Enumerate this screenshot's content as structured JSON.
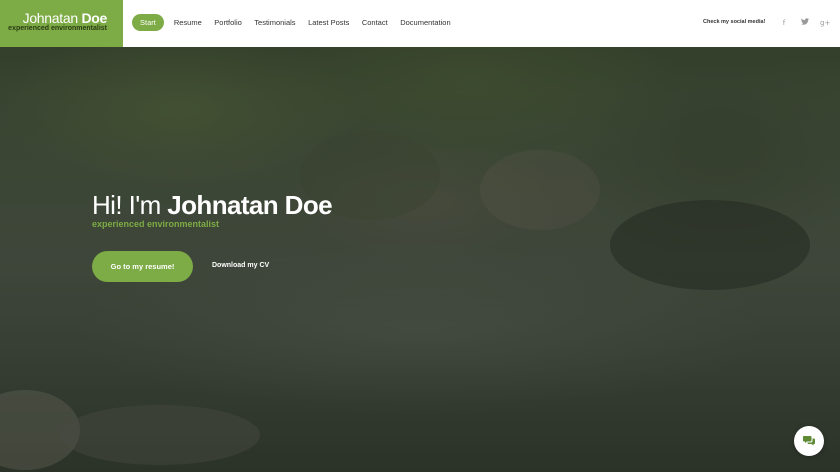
{
  "brand": {
    "first_name": "Johnatan",
    "last_name": "Doe",
    "tagline": "experienced environmentalist"
  },
  "nav": {
    "items": [
      {
        "label": "Start",
        "active": true
      },
      {
        "label": "Resume"
      },
      {
        "label": "Portfolio"
      },
      {
        "label": "Testimonials"
      },
      {
        "label": "Latest Posts"
      },
      {
        "label": "Contact"
      },
      {
        "label": "Documentation"
      }
    ]
  },
  "social": {
    "label": "Check my social media!",
    "icons": [
      {
        "name": "facebook-icon",
        "glyph": "f"
      },
      {
        "name": "twitter-icon",
        "glyph": "t"
      },
      {
        "name": "google-plus-icon",
        "glyph": "g+"
      }
    ]
  },
  "hero": {
    "greeting": "Hi! I'm",
    "name": "Johnatan Doe",
    "subtitle": "experienced environmentalist",
    "primary_button": "Go to my resume!",
    "secondary_link": "Download my CV"
  },
  "chat": {
    "icon": "chat-icon"
  },
  "colors": {
    "accent": "#7dab45",
    "header_bg": "#ffffff",
    "nav_text": "#333333",
    "social_icon": "#9a9a9a"
  }
}
